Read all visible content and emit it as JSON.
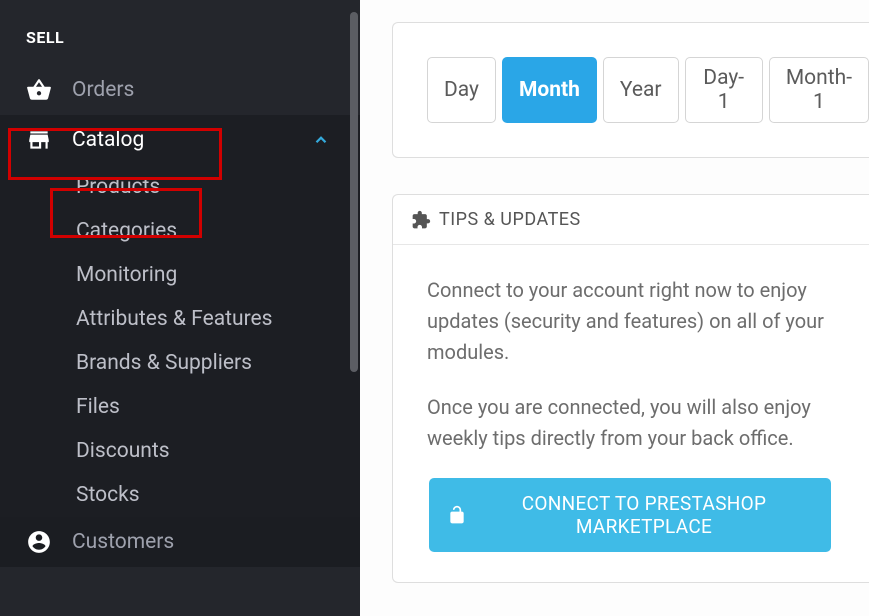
{
  "sidebar": {
    "section_title": "SELL",
    "orders": {
      "label": "Orders"
    },
    "catalog": {
      "label": "Catalog",
      "items": [
        "Products",
        "Categories",
        "Monitoring",
        "Attributes & Features",
        "Brands & Suppliers",
        "Files",
        "Discounts",
        "Stocks"
      ]
    },
    "customers": {
      "label": "Customers"
    }
  },
  "range": {
    "options": [
      "Day",
      "Month",
      "Year",
      "Day-1",
      "Month-1"
    ],
    "active": "Month"
  },
  "tips": {
    "title": "TIPS & UPDATES",
    "p1": "Connect to your account right now to enjoy updates (security and features) on all of your modules.",
    "p2": "Once you are connected, you will also enjoy weekly tips directly from your back office.",
    "button": "CONNECT TO PRESTASHOP MARKETPLACE"
  }
}
